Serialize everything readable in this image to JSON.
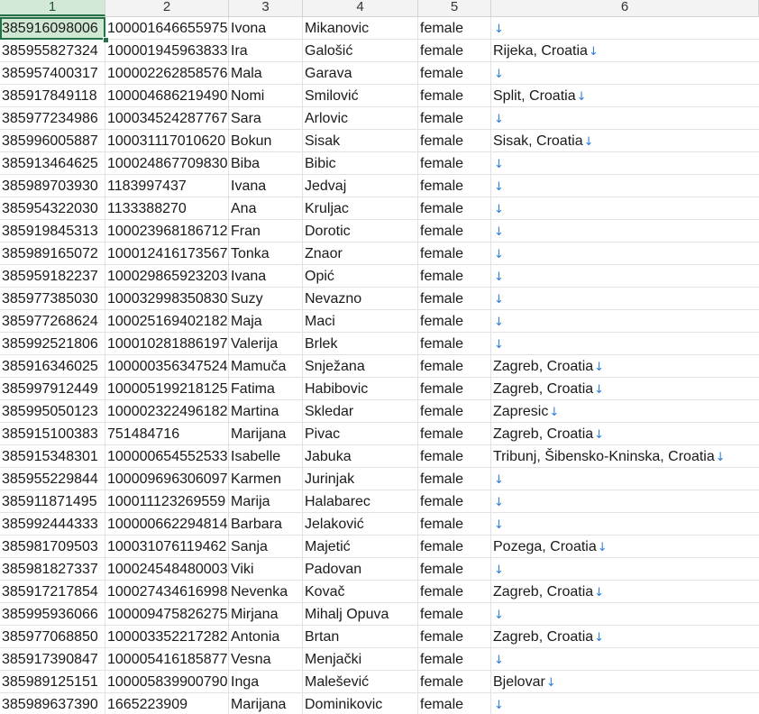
{
  "colors": {
    "selection_fill": "#cfe8d3",
    "selection_border": "#217346",
    "arrow": "#2f7fd6",
    "gridline": "#e2e2e2",
    "header_bg": "#f3f3f3"
  },
  "icons": {
    "paragraph_mark": "down-arrow-icon",
    "paragraph_mark_glyph": "↓"
  },
  "columns": [
    "1",
    "2",
    "3",
    "4",
    "5",
    "6"
  ],
  "selected_cell": {
    "row": 1,
    "col": 1
  },
  "rows": [
    [
      "385916098006",
      "100001646655975",
      "Ivona",
      "Mikanovic",
      "female",
      ""
    ],
    [
      "385955827324",
      "100001945963833",
      "Ira",
      "Galošić",
      "female",
      "Rijeka, Croatia"
    ],
    [
      "385957400317",
      "100002262858576",
      "Mala",
      "Garava",
      "female",
      ""
    ],
    [
      "385917849118",
      "100004686219490",
      "Nomi",
      "Smilović",
      "female",
      "Split, Croatia"
    ],
    [
      "385977234986",
      "100034524287767",
      "Sara",
      "Arlovic",
      "female",
      ""
    ],
    [
      "385996005887",
      "100031117010620",
      "Bokun",
      "Sisak",
      "female",
      "Sisak, Croatia"
    ],
    [
      "385913464625",
      "100024867709830",
      "Biba",
      "Bibic",
      "female",
      ""
    ],
    [
      "385989703930",
      "1183997437",
      "Ivana",
      "Jedvaj",
      "female",
      ""
    ],
    [
      "385954322030",
      "1133388270",
      "Ana",
      "Kruljac",
      "female",
      ""
    ],
    [
      "385919845313",
      "100023968186712",
      "Fran",
      "Dorotic",
      "female",
      ""
    ],
    [
      "385989165072",
      "100012416173567",
      "Tonka",
      "Znaor",
      "female",
      ""
    ],
    [
      "385959182237",
      "100029865923203",
      "Ivana",
      "Opić",
      "female",
      ""
    ],
    [
      "385977385030",
      "100032998350830",
      "Suzy",
      "Nevazno",
      "female",
      ""
    ],
    [
      "385977268624",
      "100025169402182",
      "Maja",
      "Maci",
      "female",
      ""
    ],
    [
      "385992521806",
      "100010281886197",
      "Valerija",
      "Brlek",
      "female",
      ""
    ],
    [
      "385916346025",
      "100000356347524",
      "Mamuča",
      "Snježana",
      "female",
      "Zagreb, Croatia"
    ],
    [
      "385997912449",
      "100005199218125",
      "Fatima",
      "Habibovic",
      "female",
      "Zagreb, Croatia"
    ],
    [
      "385995050123",
      "100002322496182",
      "Martina",
      "Skledar",
      "female",
      "Zapresic"
    ],
    [
      "385915100383",
      "751484716",
      "Marijana",
      "Pivac",
      "female",
      "Zagreb, Croatia"
    ],
    [
      "385915348301",
      "100000654552533",
      "Isabelle",
      "Jabuka",
      "female",
      "Tribunj, Šibensko-Kninska, Croatia"
    ],
    [
      "385955229844",
      "100009696306097",
      "Karmen",
      "Jurinjak",
      "female",
      ""
    ],
    [
      "385911871495",
      "100011123269559",
      "Marija",
      "Halabarec",
      "female",
      ""
    ],
    [
      "385992444333",
      "100000662294814",
      "Barbara",
      "Jelaković",
      "female",
      ""
    ],
    [
      "385981709503",
      "100031076119462",
      "Sanja",
      "Majetić",
      "female",
      "Pozega, Croatia"
    ],
    [
      "385981827337",
      "100024548480003",
      "Viki",
      "Padovan",
      "female",
      ""
    ],
    [
      "385917217854",
      "100027434616998",
      "Nevenka",
      "Kovač",
      "female",
      "Zagreb, Croatia"
    ],
    [
      "385995936066",
      "100009475826275",
      "Mirjana",
      "Mihalj Opuva",
      "female",
      ""
    ],
    [
      "385977068850",
      "100003352217282",
      "Antonia",
      "Brtan",
      "female",
      "Zagreb, Croatia"
    ],
    [
      "385917390847",
      "100005416185877",
      "Vesna",
      "Menjački",
      "female",
      ""
    ],
    [
      "385989125151",
      "100005839900790",
      "Inga",
      "Malešević",
      "female",
      "Bjelovar"
    ],
    [
      "385989637390",
      "1665223909",
      "Marijana",
      "Dominikovic",
      "female",
      ""
    ]
  ]
}
